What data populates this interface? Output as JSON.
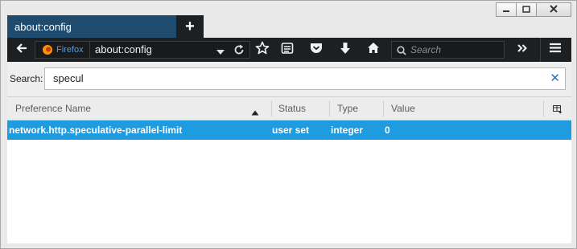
{
  "window": {
    "tab_title": "about:config",
    "new_tab_symbol": "+"
  },
  "navbar": {
    "identity_label": "Firefox",
    "url": "about:config",
    "search_placeholder": "Search"
  },
  "search": {
    "label": "Search:",
    "value": "specul"
  },
  "table": {
    "columns": [
      "Preference Name",
      "Status",
      "Type",
      "Value"
    ],
    "rows": [
      {
        "name": "network.http.speculative-parallel-limit",
        "status": "user set",
        "type": "integer",
        "value": "0"
      }
    ]
  },
  "colors": {
    "tab_active": "#1e4b6e",
    "toolbar": "#1d2022",
    "selection": "#1f9be0",
    "identity_text": "#5a9bd6"
  },
  "icons": [
    "minimize-icon",
    "maximize-icon",
    "close-icon",
    "back-icon",
    "firefox-logo-icon",
    "dropdown-icon",
    "reload-icon",
    "bookmark-star-icon",
    "reading-list-icon",
    "pocket-icon",
    "download-icon",
    "home-icon",
    "search-icon",
    "overflow-icon",
    "menu-icon",
    "clear-icon",
    "sort-ascending-icon",
    "column-picker-icon"
  ]
}
